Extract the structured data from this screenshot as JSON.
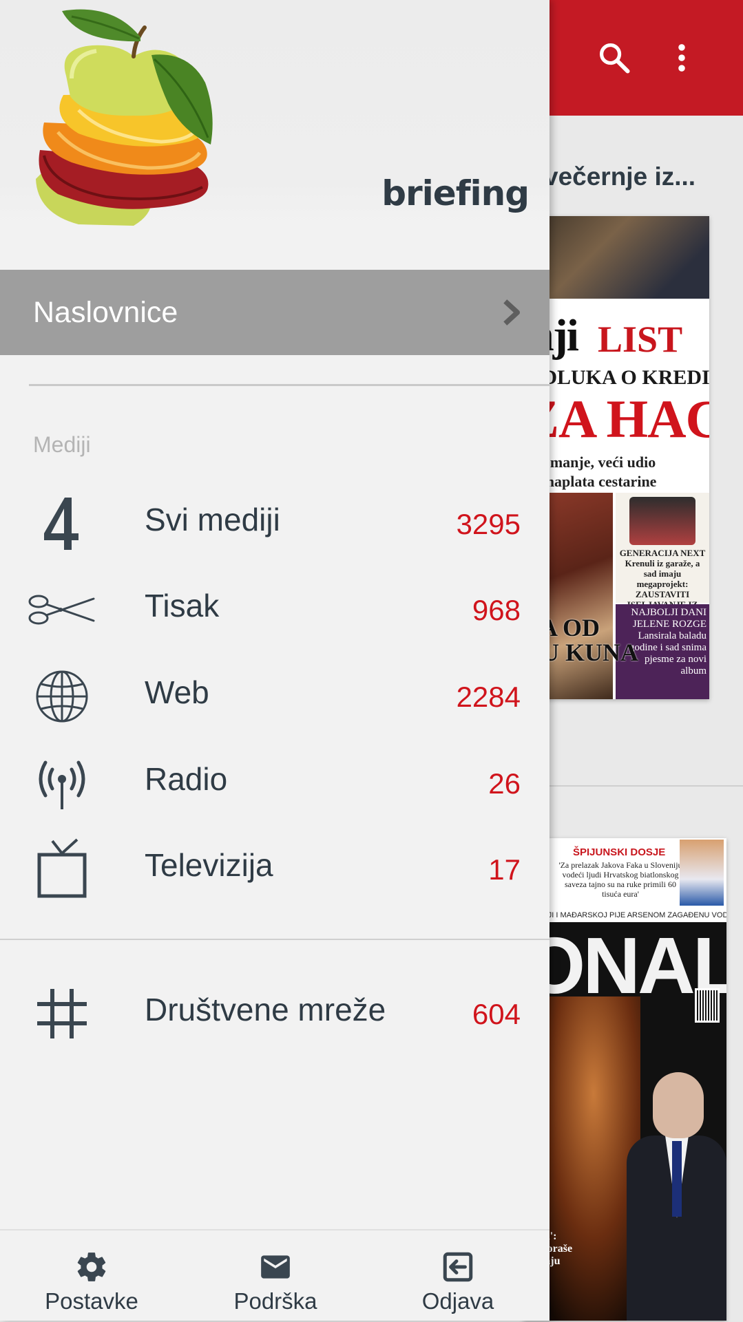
{
  "background_app": {
    "toolbar_color": "#c41a24",
    "icons": [
      "search-icon",
      "more-vert-icon"
    ],
    "list_title": "večernje iz...",
    "cover1": {
      "masthead_black": "nji",
      "masthead_red": "LIST",
      "headline_top": "ODLUKA O KREDITU",
      "headline_red": "ZA HAC",
      "subline": "adi manje, veći udio\nna naplata cestarine",
      "box_b": "GENERACIJA NEXT\nKrenuli iz garaže, a sad imaju megaprojekt:\nZAUSTAVITI ISELJAVANJE IZ SLAVONIJE",
      "box_c": "NAJBOLJI DANI JELENE ROZGE\nLansirala baladu godine i sad snima pjesme za novi album",
      "bottom": "BA OD\nDU KUNA"
    },
    "cover2": {
      "red_label": "ŠPIJUNSKI DOSJE",
      "quote": "'Za prelazak Jakova Faka u Sloveniju vodeći ljudi Hrvatskog biatlonskog saveza tajno su na ruke primili 60 tisuća eura'",
      "strip": ", SRBIJI I MAĐARSKOJ PIJE ARSENOM ZAGAĐENU VODU",
      "masthead": "ONAL",
      "bottom_left": "buna':\ne šatoraše\nremaju\n\nović"
    }
  },
  "drawer": {
    "brand": "briefing",
    "active_section": "Naslovnice",
    "group_label": "Mediji",
    "media": [
      {
        "icon": "four-icon",
        "name": "Svi mediji",
        "count": "3295"
      },
      {
        "icon": "scissors-icon",
        "name": "Tisak",
        "count": "968"
      },
      {
        "icon": "globe-icon",
        "name": "Web",
        "count": "2284"
      },
      {
        "icon": "radio-antenna-icon",
        "name": "Radio",
        "count": "26"
      },
      {
        "icon": "tv-icon",
        "name": "Televizija",
        "count": "17"
      }
    ],
    "social": {
      "icon": "hashtag-icon",
      "name": "Društvene mreže",
      "count": "604"
    },
    "bottom_bar": [
      {
        "icon": "gear-icon",
        "label": "Postavke"
      },
      {
        "icon": "mail-icon",
        "label": "Podrška"
      },
      {
        "icon": "logout-icon",
        "label": "Odjava"
      }
    ],
    "accent_color": "#d0141c",
    "active_bg": "#9e9e9e"
  }
}
